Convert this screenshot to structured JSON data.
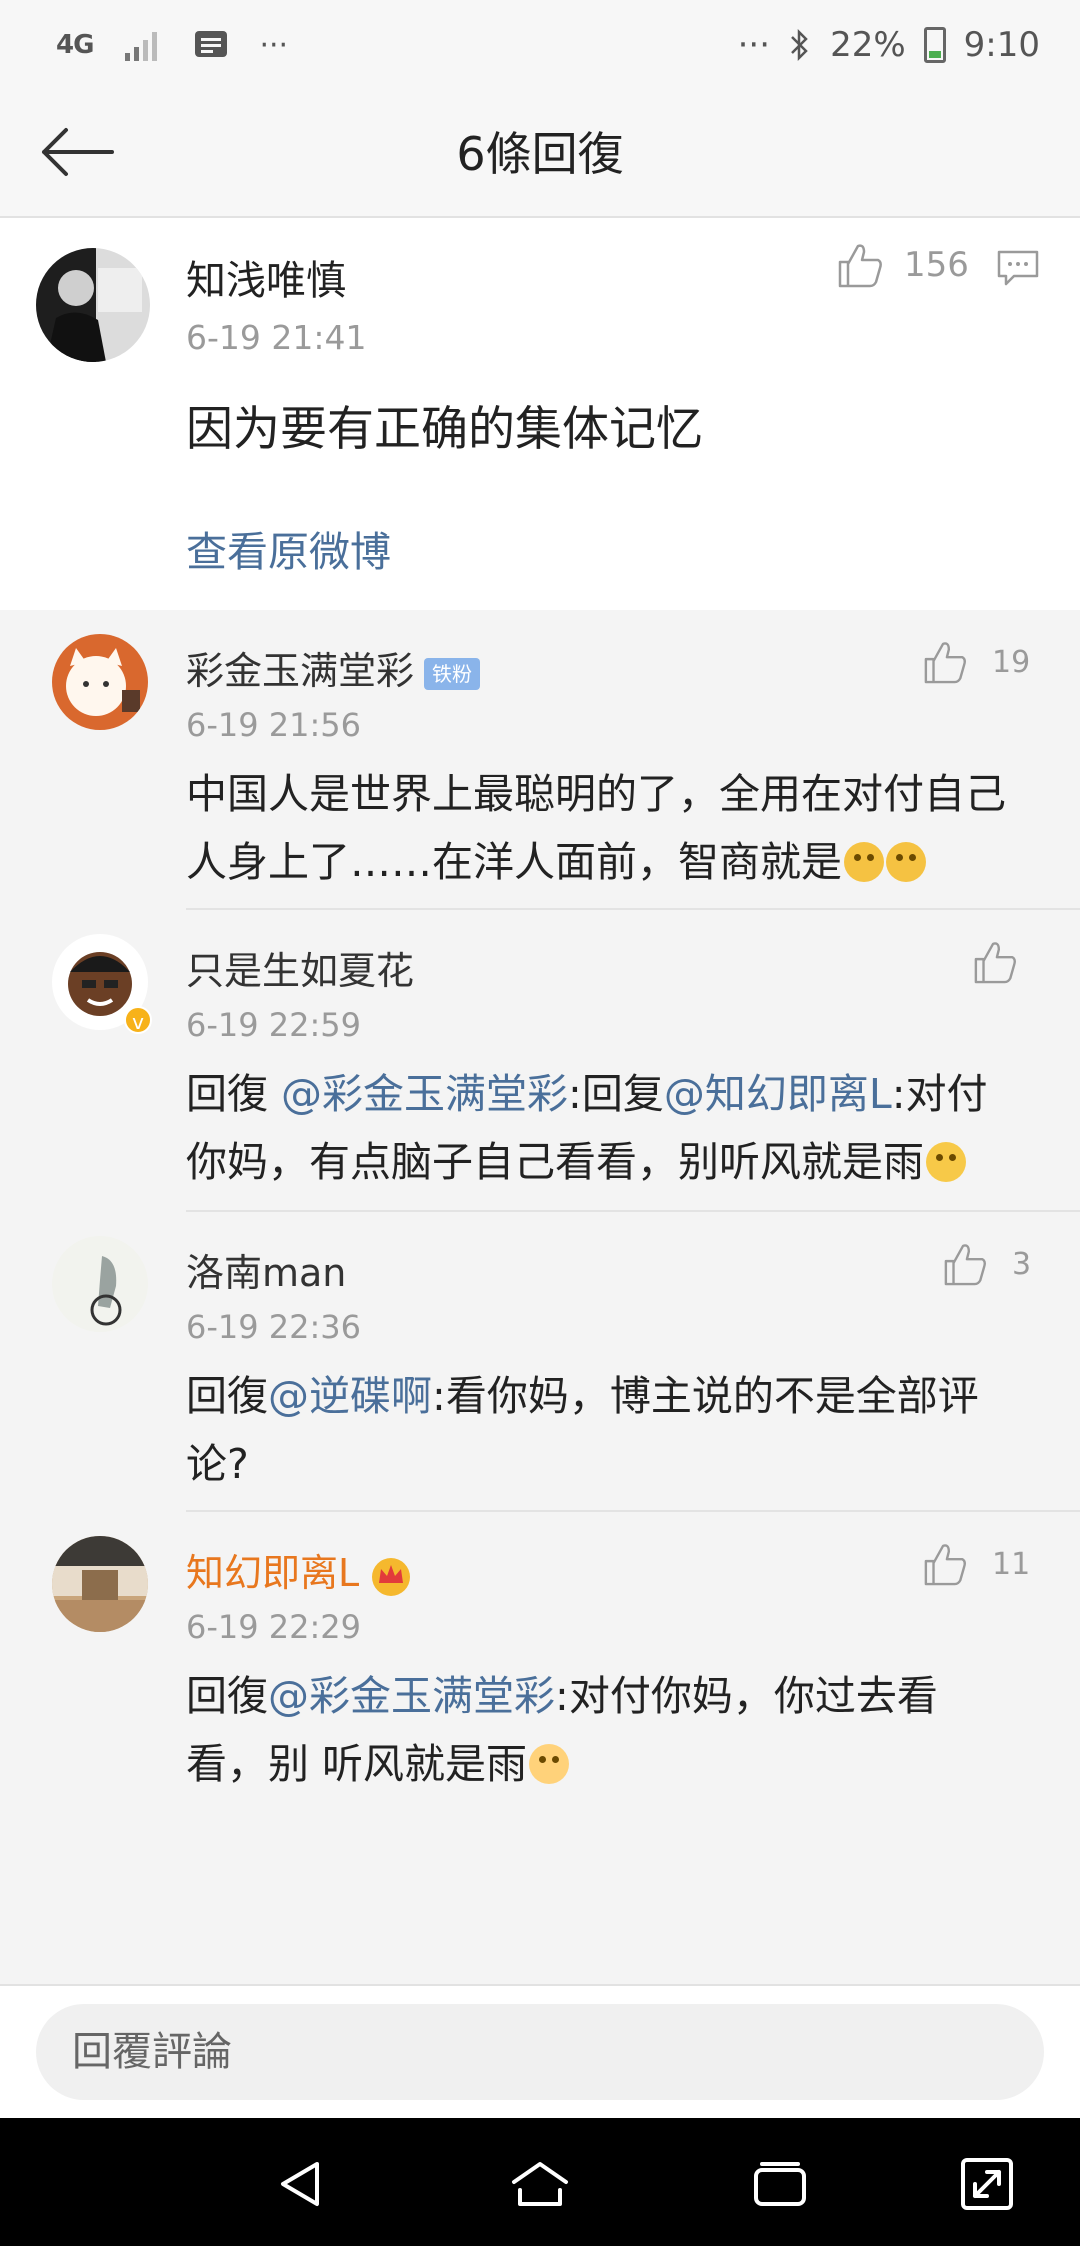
{
  "status_bar": {
    "network": "4G",
    "overflow_left": "···",
    "overflow_right": "···",
    "battery": "22%",
    "time": "9:10"
  },
  "header": {
    "title": "6條回復"
  },
  "main_comment": {
    "name": "知浅唯慎",
    "time": "6-19 21:41",
    "likes": "156",
    "text": "因为要有正确的集体记忆",
    "view_original": "查看原微博"
  },
  "replies": [
    {
      "name": "彩金玉满堂彩",
      "badge": "铁粉",
      "time": "6-19 21:56",
      "likes": "19",
      "text": "中国人是世界上最聪明的了，全用在对付自己人身上了……在洋人面前，智商就是"
    },
    {
      "name": "只是生如夏花",
      "time": "6-19 22:59",
      "likes": "",
      "prefix": "回復 ",
      "mention1": "@彩金玉满堂彩",
      "mid": ":回复",
      "mention2": "@知幻即离L",
      "rest": ":对付你妈，有点脑子自己看看，别听风就是雨"
    },
    {
      "name": "洛南man",
      "time": "6-19 22:36",
      "likes": "3",
      "prefix": "回復",
      "mention1": "@逆碟啊",
      "rest": ":看你妈，博主说的不是全部评论?"
    },
    {
      "name": "知幻即离L",
      "time": "6-19 22:29",
      "likes": "11",
      "prefix": "回復",
      "mention1": "@彩金玉满堂彩",
      "rest": ":对付你妈，你过去看看，别 听风就是雨"
    }
  ],
  "input": {
    "placeholder": "回覆評論"
  },
  "colors": {
    "link": "#4a6f9a",
    "vip_name": "#e8771e",
    "badge": "#8ab4ea"
  },
  "icons": [
    "back-arrow-icon",
    "thumb-up-icon",
    "comment-icon",
    "nav-back-icon",
    "nav-home-icon",
    "nav-recents-icon",
    "nav-expand-icon"
  ]
}
